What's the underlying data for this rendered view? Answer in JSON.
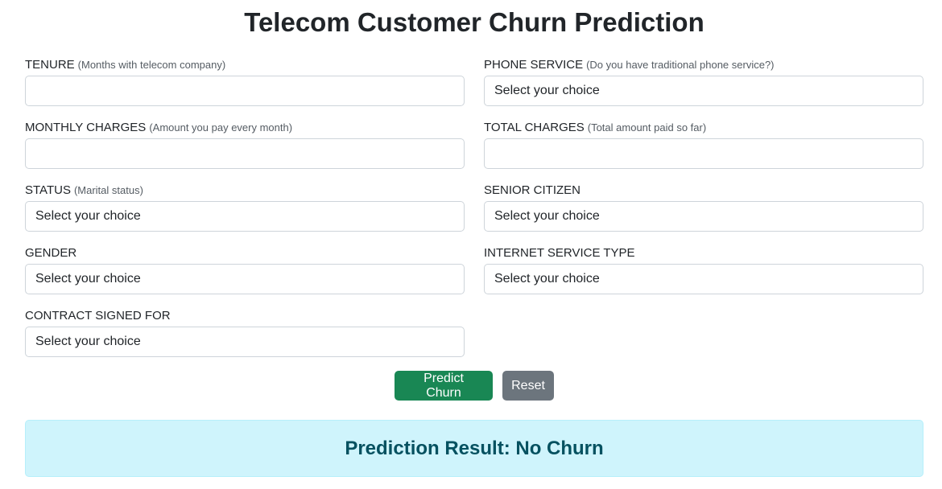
{
  "page": {
    "title": "Telecom Customer Churn Prediction"
  },
  "fields": {
    "tenure": {
      "label": "TENURE",
      "hint": "(Months with telecom company)",
      "value": ""
    },
    "phone_service": {
      "label": "PHONE SERVICE",
      "hint": "(Do you have traditional phone service?)",
      "selected": "Select your choice"
    },
    "monthly_charges": {
      "label": "MONTHLY CHARGES",
      "hint": "(Amount you pay every month)",
      "value": ""
    },
    "total_charges": {
      "label": "TOTAL CHARGES",
      "hint": "(Total amount paid so far)",
      "value": ""
    },
    "status": {
      "label": "STATUS",
      "hint": "(Marital status)",
      "selected": "Select your choice"
    },
    "senior_citizen": {
      "label": "SENIOR CITIZEN",
      "selected": "Select your choice"
    },
    "gender": {
      "label": "GENDER",
      "selected": "Select your choice"
    },
    "internet_service": {
      "label": "INTERNET SERVICE TYPE",
      "selected": "Select your choice"
    },
    "contract": {
      "label": "CONTRACT SIGNED FOR",
      "selected": "Select your choice"
    }
  },
  "buttons": {
    "predict_label": "Predict Churn",
    "reset_label": "Reset"
  },
  "result": {
    "text": "Prediction Result: No Churn"
  },
  "colors": {
    "predict_button": "#198754",
    "reset_button": "#6c757d",
    "result_background": "#cff4fc",
    "result_text": "#055160"
  }
}
